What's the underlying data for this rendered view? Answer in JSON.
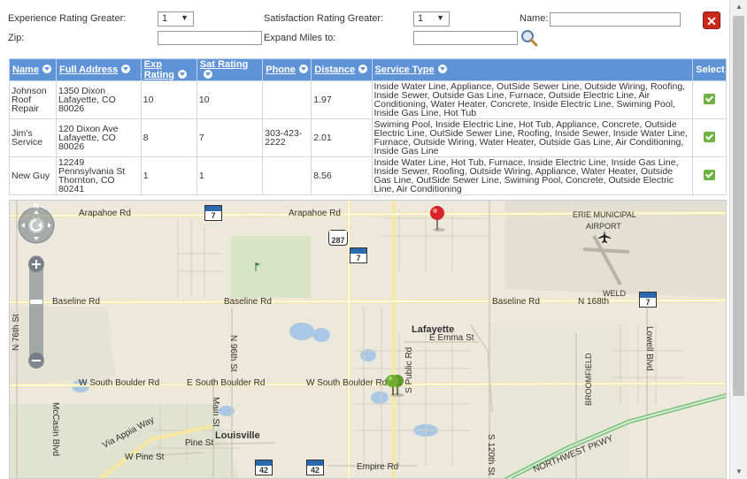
{
  "filters": {
    "exp_label": "Experience Rating Greater:",
    "exp_value": "1",
    "sat_label": "Satisfaction Rating Greater:",
    "sat_value": "1",
    "name_label": "Name:",
    "name_value": "",
    "zip_label": "Zip:",
    "zip_value": "",
    "miles_label": "Expand Miles to:",
    "miles_value": ""
  },
  "table": {
    "headers": [
      "Name",
      "Full Address",
      "Exp Rating",
      "Sat Rating",
      "Phone",
      "Distance",
      "Service Type",
      "Select"
    ],
    "rows": [
      {
        "name": "Johnson Roof Repair",
        "address": "1350 Dixon Lafayette, CO 80026",
        "exp": "10",
        "sat": "10",
        "phone": "",
        "distance": "1.97",
        "service": "Inside Water Line, Appliance, OutSide Sewer Line, Outside Wiring, Roofing, Inside Sewer, Outside Gas Line, Furnace, Outside Electric Line, Air Conditioning, Water Heater, Concrete, Inside Electric Line, Swiming Pool, Inside Gas Line, Hot Tub"
      },
      {
        "name": "Jim's Service",
        "address": "120 Dixon Ave Lafayette, CO 80026",
        "exp": "8",
        "sat": "7",
        "phone": "303-423-2222",
        "distance": "2.01",
        "service": "Swiming Pool, Inside Electric Line, Hot Tub, Appliance, Concrete, Outside Electric Line, OutSide Sewer Line, Roofing, Inside Sewer, Inside Water Line, Furnace, Outside Wiring, Water Heater, Outside Gas Line, Air Conditioning, Inside Gas Line"
      },
      {
        "name": "New Guy",
        "address": "12249 Pennsylvania St Thornton, CO 80241",
        "exp": "1",
        "sat": "1",
        "phone": "",
        "distance": "8.56",
        "service": "Inside Water Line, Hot Tub, Furnace, Inside Electric Line, Inside Gas Line, Inside Sewer, Roofing, Outside Wiring, Appliance, Water Heater, Outside Gas Line, OutSide Sewer Line, Swiming Pool, Concrete, Outside Electric Line, Air Conditioning"
      }
    ]
  },
  "map": {
    "roads": {
      "arapahoe_w": "Arapahoe Rd",
      "arapahoe_e": "Arapahoe Rd",
      "baseline_w": "Baseline Rd",
      "baseline_m": "Baseline Rd",
      "baseline_e": "Baseline Rd",
      "n168": "N 168th",
      "sb_w": "W South Boulder Rd",
      "sb_m": "E South Boulder Rd",
      "sb_e": "W South Boulder Rd",
      "emma": "E Emma St",
      "via_appia": "Via Appia Way",
      "w_pine": "W Pine St",
      "pine": "Pine St",
      "empire": "Empire Rd",
      "nw_pkwy": "NORTHWEST PKWY",
      "n76": "N 76th St",
      "n96": "N 96th St",
      "mccaslin": "McCasin Blvd",
      "main": "Main St",
      "public": "S Public Rd",
      "s120": "S 120th St",
      "broomfield": "BROOMFIELD",
      "lowell": "Lowell Blvd"
    },
    "places": {
      "erie": "ERIE MUNICIPAL",
      "airport": "AIRPORT",
      "weld": "WELD",
      "lafayette": "Lafayette",
      "louisville": "Louisville"
    },
    "shields": [
      "7",
      "287",
      "7",
      "7",
      "42",
      "42",
      "7"
    ],
    "compass": "N"
  }
}
